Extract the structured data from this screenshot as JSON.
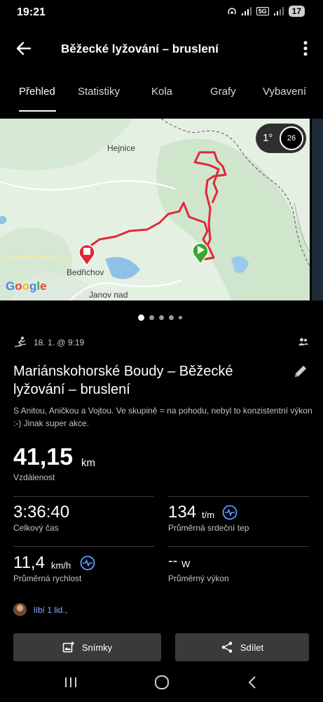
{
  "status_bar": {
    "time": "19:21",
    "network": "5G",
    "battery": "17"
  },
  "header": {
    "title": "Běžecké lyžování – bruslení",
    "back_icon": "arrow-left-icon",
    "more_icon": "more-vertical-icon"
  },
  "tabs": [
    {
      "label": "Přehled",
      "active": true
    },
    {
      "label": "Statistiky",
      "active": false
    },
    {
      "label": "Kola",
      "active": false
    },
    {
      "label": "Grafy",
      "active": false
    },
    {
      "label": "Vybavení",
      "active": false
    }
  ],
  "map": {
    "labels": [
      "Hejnice",
      "Bedřichov",
      "Janov nad"
    ],
    "provider": "Google",
    "weather": {
      "temperature": "1°",
      "wind": "26"
    },
    "route_color": "#e0283a",
    "start_marker_color": "#3aa62e",
    "end_marker_color": "#e0283a"
  },
  "pager": {
    "count": 5,
    "active_index": 0
  },
  "activity": {
    "date": "18. 1. @ 9:19",
    "title": "Mariánskohorské Boudy – Běžecké lyžování – bruslení",
    "description": "S Anitou, Aničkou a Vojtou. Ve skupině = na pohodu, nebyl to konzistentní výkon :-) Jinak super akce."
  },
  "stats": {
    "distance": {
      "value": "41,15",
      "unit": "km",
      "label": "Vzdálenost"
    },
    "total_time": {
      "value": "3:36:40",
      "label": "Celkový čas"
    },
    "heart_rate": {
      "value": "134",
      "unit": "t/m",
      "label": "Průměrná srdeční tep"
    },
    "speed": {
      "value": "11,4",
      "unit": "km/h",
      "label": "Průměrná rychlost"
    },
    "power": {
      "value": "--",
      "unit": "W",
      "label": "Průměrný výkon"
    }
  },
  "likes": {
    "text": "líbí 1 lid.,"
  },
  "actions": {
    "photos_label": "Snímky",
    "share_label": "Sdílet"
  },
  "colors": {
    "accent_blue": "#5c9dff",
    "link_blue": "#7fb2ff",
    "background": "#000000"
  }
}
